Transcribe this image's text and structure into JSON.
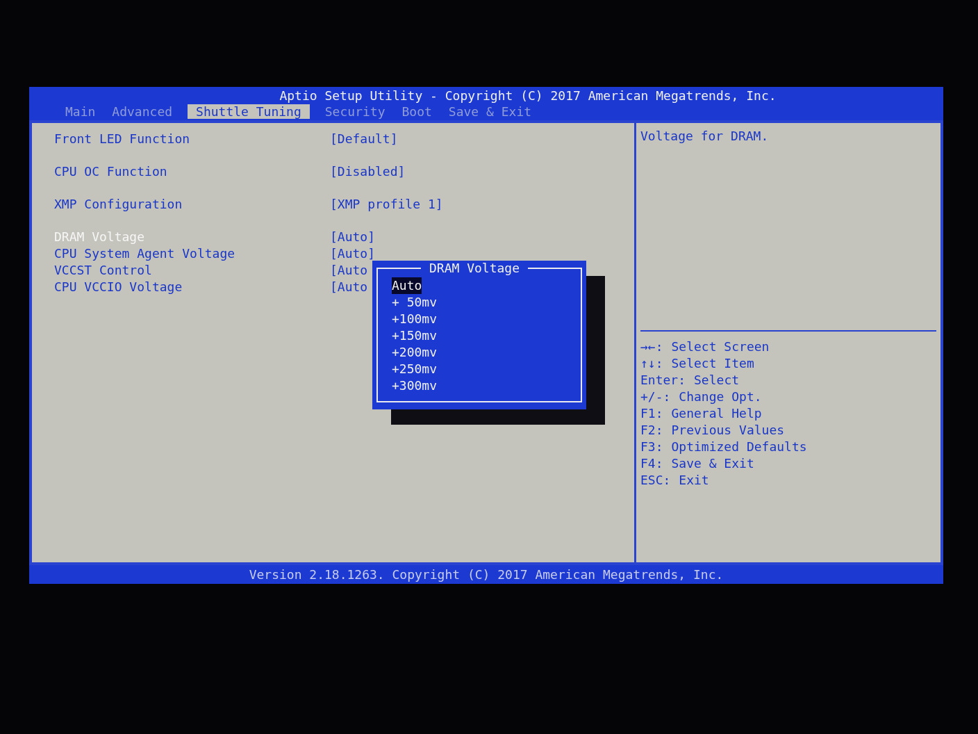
{
  "header": {
    "title": "Aptio Setup Utility - Copyright (C) 2017 American Megatrends, Inc."
  },
  "tabs": [
    {
      "label": "Main",
      "selected": false
    },
    {
      "label": "Advanced",
      "selected": false
    },
    {
      "label": "Shuttle Tuning",
      "selected": true
    },
    {
      "label": "Security",
      "selected": false
    },
    {
      "label": "Boot",
      "selected": false
    },
    {
      "label": "Save & Exit",
      "selected": false
    }
  ],
  "setting_groups": [
    {
      "items": [
        {
          "label": "Front LED Function",
          "value": "[Default]",
          "selected": false
        }
      ]
    },
    {
      "items": [
        {
          "label": "CPU OC Function",
          "value": "[Disabled]",
          "selected": false
        }
      ]
    },
    {
      "items": [
        {
          "label": "XMP Configuration",
          "value": "[XMP profile 1]",
          "selected": false
        }
      ]
    },
    {
      "items": [
        {
          "label": "DRAM Voltage",
          "value": "[Auto]",
          "selected": true
        },
        {
          "label": "CPU System Agent Voltage",
          "value": "[Auto]",
          "selected": false
        },
        {
          "label": "VCCST Control",
          "value": "[Auto",
          "selected": false
        },
        {
          "label": "CPU VCCIO Voltage",
          "value": "[Auto",
          "selected": false
        }
      ]
    }
  ],
  "popup": {
    "title": "DRAM Voltage",
    "options": [
      {
        "label": "Auto",
        "selected": true
      },
      {
        "label": "+ 50mv",
        "selected": false
      },
      {
        "label": "+100mv",
        "selected": false
      },
      {
        "label": "+150mv",
        "selected": false
      },
      {
        "label": "+200mv",
        "selected": false
      },
      {
        "label": "+250mv",
        "selected": false
      },
      {
        "label": "+300mv",
        "selected": false
      }
    ]
  },
  "help_text": "Voltage for DRAM.",
  "key_hints": [
    {
      "key": "→←:",
      "action": "Select Screen"
    },
    {
      "key": "↑↓:",
      "action": "Select Item"
    },
    {
      "key": "Enter:",
      "action": "Select"
    },
    {
      "key": "+/-:",
      "action": "Change Opt."
    },
    {
      "key": "F1:",
      "action": "General Help"
    },
    {
      "key": "F2:",
      "action": "Previous Values"
    },
    {
      "key": "F3:",
      "action": "Optimized Defaults"
    },
    {
      "key": "F4:",
      "action": "Save & Exit"
    },
    {
      "key": "ESC:",
      "action": "Exit"
    }
  ],
  "footer": {
    "text": "Version 2.18.1263. Copyright (C) 2017 American Megatrends, Inc."
  }
}
